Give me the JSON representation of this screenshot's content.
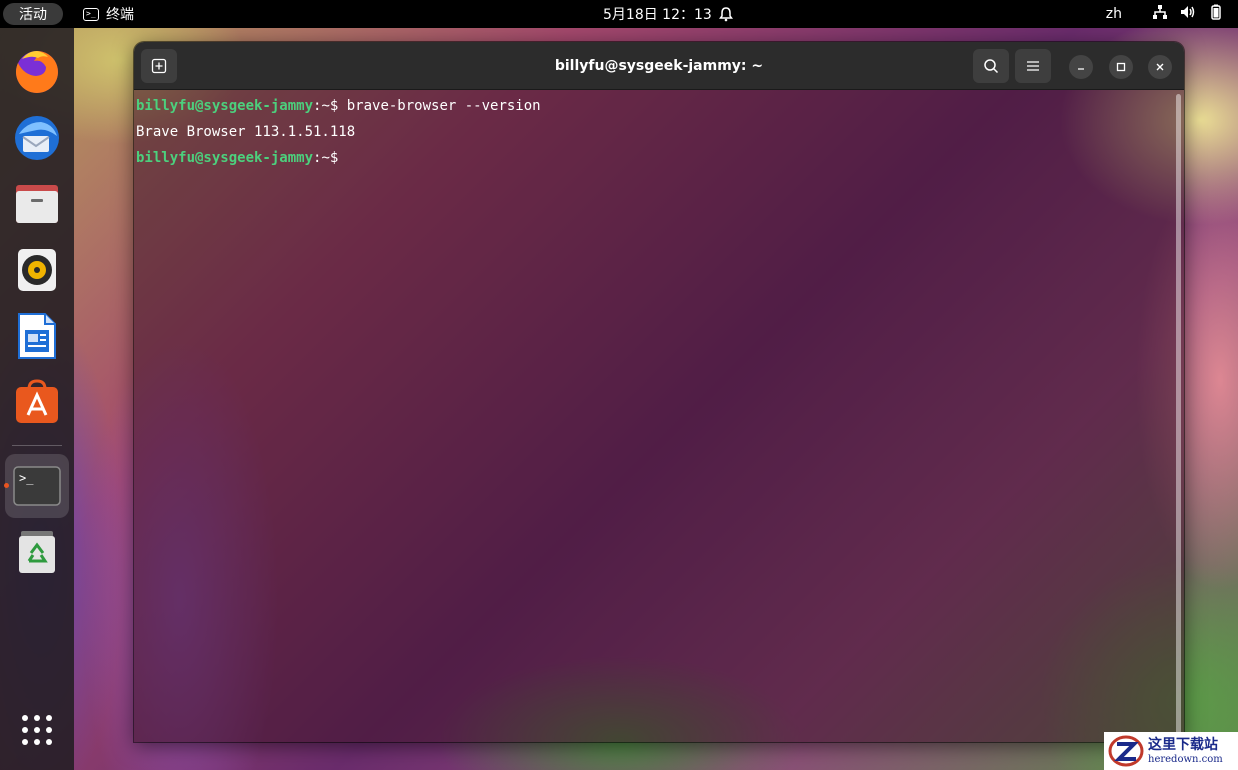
{
  "topbar": {
    "activities_label": "活动",
    "app_name": "终端",
    "app_icon": "terminal-icon",
    "clock": "5月18日  12：13",
    "notification_icon": "bell-icon",
    "language": "zh",
    "tray_icons": [
      "network-icon",
      "volume-icon",
      "battery-icon"
    ]
  },
  "dock": {
    "items": [
      {
        "name": "firefox",
        "icon": "firefox-icon"
      },
      {
        "name": "thunderbird",
        "icon": "thunderbird-icon"
      },
      {
        "name": "files",
        "icon": "files-icon"
      },
      {
        "name": "rhythmbox",
        "icon": "rhythmbox-icon"
      },
      {
        "name": "libreoffice-writer",
        "icon": "writer-icon"
      },
      {
        "name": "ubuntu-software",
        "icon": "software-icon"
      },
      {
        "name": "terminal",
        "icon": "terminal-icon",
        "active": true
      },
      {
        "name": "trash",
        "icon": "trash-icon"
      }
    ],
    "show_apps_icon": "app-grid-icon",
    "running_indicator_color": "#e95420"
  },
  "terminal": {
    "title": "billyfu@sysgeek-jammy: ~",
    "lines": [
      {
        "prompt_user": "billyfu@sysgeek-jammy",
        "prompt_rest": ":~$ ",
        "command": "brave-browser --version"
      },
      {
        "output": "Brave Browser 113.1.51.118"
      },
      {
        "prompt_user": "billyfu@sysgeek-jammy",
        "prompt_rest": ":~$ ",
        "command": ""
      }
    ],
    "prompt_color": "#4cd07d",
    "text_color": "#ffffff"
  },
  "watermark": {
    "chinese": "这里下载站",
    "url": "heredown.com"
  }
}
